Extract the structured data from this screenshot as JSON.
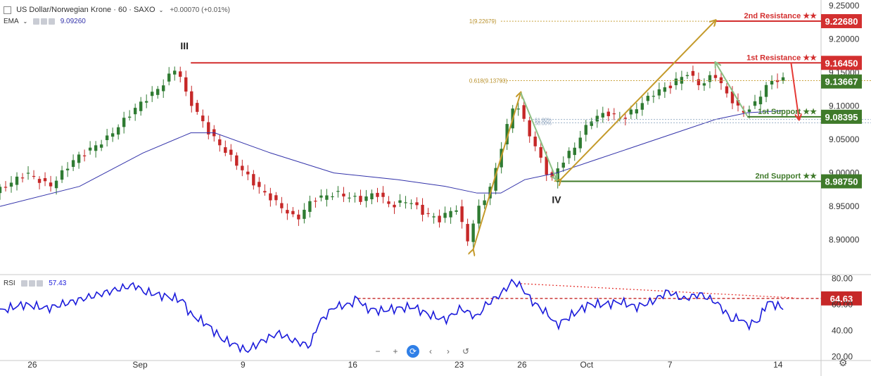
{
  "header": {
    "symbol_title": "US Dollar/Norwegian Krone · 60 · SAXO",
    "change": "+0.00070 (+0.01%)",
    "indicator_name": "EMA",
    "indicator_value": "9.09260",
    "rsi_name": "RSI",
    "rsi_value": "57.43"
  },
  "navigation": {
    "zoom_out": "−",
    "zoom_in": "+",
    "reset": "⟳",
    "scroll_left": "‹",
    "scroll_right": "›",
    "undo": "↺"
  },
  "settings_icon": "gear-icon",
  "colors": {
    "up": "#2f7b32",
    "down": "#c62828",
    "ema": "#3333aa",
    "rsi": "#1a1adb",
    "resistance": "#d32f2f",
    "support": "#3f7a2a",
    "fib": "#c8a23c",
    "arrow_gold": "#c49a2a",
    "arrow_green": "#8cc084",
    "arrow_red": "#e53935"
  },
  "chart_data": [
    {
      "type": "candlestick",
      "instrument": "US Dollar/Norwegian Krone",
      "interval": "60",
      "source": "SAXO",
      "ylim": [
        8.865,
        9.25
      ],
      "y_ticks": [
        "9.25000",
        "9.20000",
        "9.15000",
        "9.10000",
        "9.05000",
        "9.00000",
        "8.95000",
        "8.90000"
      ],
      "x_ticks": [
        "26",
        "Sep",
        "9",
        "16",
        "23",
        "26",
        "Oct",
        "7",
        "14"
      ],
      "price_path": [
        [
          0,
          8.97
        ],
        [
          4,
          9.0
        ],
        [
          7,
          8.98
        ],
        [
          10,
          9.02
        ],
        [
          14,
          9.05
        ],
        [
          18,
          9.1
        ],
        [
          21,
          9.13
        ],
        [
          23,
          9.16
        ],
        [
          24,
          9.12
        ],
        [
          27,
          9.06
        ],
        [
          30,
          9.02
        ],
        [
          33,
          8.98
        ],
        [
          36,
          8.95
        ],
        [
          38,
          8.93
        ],
        [
          40,
          8.96
        ],
        [
          43,
          8.97
        ],
        [
          46,
          8.96
        ],
        [
          48,
          8.97
        ],
        [
          50,
          8.95
        ],
        [
          52,
          8.96
        ],
        [
          54,
          8.94
        ],
        [
          56,
          8.93
        ],
        [
          58,
          8.95
        ],
        [
          59.5,
          8.9
        ],
        [
          61,
          8.95
        ],
        [
          62.5,
          8.98
        ],
        [
          64,
          9.05
        ],
        [
          65.5,
          9.11
        ],
        [
          66.5,
          9.08
        ],
        [
          68,
          9.04
        ],
        [
          69.5,
          9.0
        ],
        [
          70.2,
          8.99
        ],
        [
          71,
          9.01
        ],
        [
          73,
          9.04
        ],
        [
          75,
          9.08
        ],
        [
          77,
          9.09
        ],
        [
          79,
          9.08
        ],
        [
          81,
          9.1
        ],
        [
          83,
          9.12
        ],
        [
          85,
          9.13
        ],
        [
          87,
          9.15
        ],
        [
          89,
          9.13
        ],
        [
          90.5,
          9.15
        ],
        [
          92,
          9.12
        ],
        [
          94,
          9.09
        ],
        [
          95.5,
          9.1
        ],
        [
          97,
          9.13
        ],
        [
          98.5,
          9.14
        ]
      ],
      "ema_path": [
        [
          0,
          8.95
        ],
        [
          10,
          8.98
        ],
        [
          18,
          9.03
        ],
        [
          24,
          9.06
        ],
        [
          27,
          9.06
        ],
        [
          34,
          9.03
        ],
        [
          42,
          9.0
        ],
        [
          50,
          8.99
        ],
        [
          56,
          8.98
        ],
        [
          60,
          8.97
        ],
        [
          63,
          8.97
        ],
        [
          66,
          8.99
        ],
        [
          70,
          9.0
        ],
        [
          75,
          9.02
        ],
        [
          80,
          9.04
        ],
        [
          85,
          9.06
        ],
        [
          90,
          9.08
        ],
        [
          94,
          9.09
        ],
        [
          98.5,
          9.093
        ]
      ],
      "levels": [
        {
          "label": "2nd Resistance ★★",
          "value": "9.22680",
          "y": 9.2268,
          "kind": "resistance",
          "x_start": 90
        },
        {
          "label": "1st Resistance ★★",
          "value": "9.16450",
          "y": 9.1645,
          "kind": "resistance",
          "x_start": 24
        },
        {
          "label": "1st Support ★★",
          "value": "9.08395",
          "y": 9.08395,
          "kind": "support",
          "x_start": 94
        },
        {
          "label": "2nd Support ★★",
          "value": "8.98750",
          "y": 8.9875,
          "kind": "support",
          "x_start": 70
        }
      ],
      "last_price": {
        "value": "9.13667",
        "y": 9.13667
      },
      "fibs": [
        {
          "label": "1(9.22679)",
          "y": 9.22679,
          "x_start": 63,
          "x_end": 90
        },
        {
          "label": "0.618(9.13793)",
          "y": 9.13793,
          "x_start": 63,
          "x_end": 116
        },
        {
          "label": "61.80%",
          "y": 9.08,
          "x_start": 67,
          "x_end": 116
        },
        {
          "label": "50.00%",
          "y": 9.075,
          "x_start": 67,
          "x_end": 116
        }
      ],
      "wave_labels": [
        {
          "text": "III",
          "x": 23.2,
          "y": 9.185
        },
        {
          "text": "IV",
          "x": 70,
          "y": 8.955
        }
      ],
      "arrows": [
        {
          "kind": "gold",
          "from": [
            59.5,
            8.885
          ],
          "to": [
            65.5,
            9.12
          ]
        },
        {
          "kind": "gold",
          "from": [
            70.5,
            8.99
          ],
          "to": [
            90,
            9.228
          ]
        },
        {
          "kind": "green",
          "from": [
            65.5,
            9.12
          ],
          "to": [
            70,
            8.99
          ]
        },
        {
          "kind": "green",
          "from": [
            94,
            9.085
          ],
          "to": [
            90,
            9.165
          ]
        },
        {
          "kind": "red",
          "from": [
            99.5,
            9.165
          ],
          "to": [
            100.5,
            9.08
          ]
        }
      ]
    },
    {
      "type": "line",
      "name": "RSI",
      "ylim": [
        18,
        84
      ],
      "y_ticks": [
        "80.00",
        "60.00",
        "40.00",
        "20.00"
      ],
      "level": {
        "value": "64.63",
        "y": 64.63,
        "x_start": 45
      },
      "trendline": {
        "from": [
          65.5,
          76
        ],
        "to": [
          100,
          65
        ]
      },
      "rsi_path": [
        [
          0,
          55
        ],
        [
          3,
          60
        ],
        [
          6,
          57
        ],
        [
          9,
          62
        ],
        [
          12,
          67
        ],
        [
          15,
          72
        ],
        [
          17,
          75
        ],
        [
          18,
          70
        ],
        [
          21,
          66
        ],
        [
          23,
          63
        ],
        [
          24,
          52
        ],
        [
          26,
          45
        ],
        [
          28,
          33
        ],
        [
          30,
          28
        ],
        [
          31,
          24
        ],
        [
          33,
          32
        ],
        [
          35,
          38
        ],
        [
          37,
          32
        ],
        [
          39,
          28
        ],
        [
          40,
          45
        ],
        [
          42,
          58
        ],
        [
          44,
          60
        ],
        [
          45,
          65
        ],
        [
          46,
          57
        ],
        [
          48,
          55
        ],
        [
          50,
          57
        ],
        [
          52,
          58
        ],
        [
          54,
          52
        ],
        [
          56,
          48
        ],
        [
          58,
          57
        ],
        [
          60,
          50
        ],
        [
          61,
          59
        ],
        [
          63,
          68
        ],
        [
          64.5,
          78
        ],
        [
          65.5,
          74
        ],
        [
          67,
          62
        ],
        [
          69,
          52
        ],
        [
          70,
          44
        ],
        [
          72,
          52
        ],
        [
          74,
          60
        ],
        [
          76,
          60
        ],
        [
          78,
          62
        ],
        [
          80,
          58
        ],
        [
          82,
          62
        ],
        [
          84,
          70
        ],
        [
          86,
          64
        ],
        [
          88,
          68
        ],
        [
          90,
          62
        ],
        [
          91,
          56
        ],
        [
          92,
          48
        ],
        [
          93,
          50
        ],
        [
          94,
          44
        ],
        [
          95.5,
          48
        ],
        [
          96.5,
          62
        ],
        [
          97.5,
          60
        ],
        [
          98.5,
          57
        ]
      ]
    }
  ]
}
